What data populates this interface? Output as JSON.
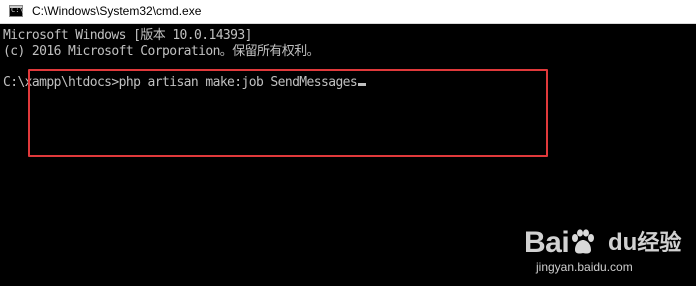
{
  "window": {
    "title": "C:\\Windows\\System32\\cmd.exe",
    "icon": "cmd-icon"
  },
  "console": {
    "line1": "Microsoft Windows [版本 10.0.14393]",
    "line2": "(c) 2016 Microsoft Corporation。保留所有权利。",
    "prompt": "C:\\xampp\\htdocs>",
    "command": "php artisan make:job SendMessages",
    "highlight_color": "#e0393b"
  },
  "watermark": {
    "brand": "Bai",
    "brand_suffix": "du",
    "brand_cn": "经验",
    "url": "jingyan.baidu.com"
  }
}
